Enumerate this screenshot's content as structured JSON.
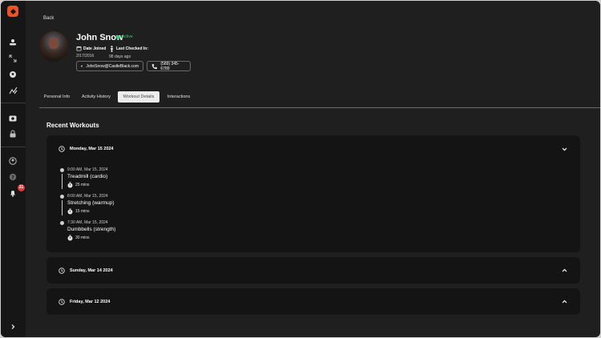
{
  "app": {
    "accent": "#e8542a",
    "notification_count": "21"
  },
  "sidebar": {
    "icons": [
      "logo-icon",
      "dashboard-icon",
      "expand-icon",
      "location-icon",
      "analytics-icon",
      "camera-icon",
      "lock-icon",
      "user-icon",
      "help-icon",
      "bell-icon",
      "chevron-right-icon"
    ]
  },
  "header": {
    "back_label": "Back"
  },
  "profile": {
    "name": "John Snow",
    "status": "Active",
    "status_color": "#2ecc71",
    "date_joined_label": "Date Joined",
    "date_joined_value": "2/17/2016",
    "last_checked_label": "Last Checked In:",
    "last_checked_value": "98 days ago",
    "email": "JohnSnow@CastleBlack.com",
    "phone": "(589) 345-6789"
  },
  "tabs": [
    {
      "label": "Personal Info",
      "active": false
    },
    {
      "label": "Activity History",
      "active": false
    },
    {
      "label": "Workout Details",
      "active": true
    },
    {
      "label": "Interactions",
      "active": false
    }
  ],
  "workouts": {
    "title": "Recent Workouts",
    "days": [
      {
        "date": "Monday, Mar 15 2024",
        "expanded": true,
        "items": [
          {
            "time": "9:00 AM, Mar 15, 2024",
            "name": "Treadmill (cardio)",
            "duration": "25 mins"
          },
          {
            "time": "8:00 AM, Mar 15, 2024",
            "name": "Stretching (warmup)",
            "duration": "15 mins"
          },
          {
            "time": "7:30 AM, Mar 15, 2024",
            "name": "Dumbbells (strength)",
            "duration": "30 mins"
          }
        ]
      },
      {
        "date": "Sunday, Mar 14 2024",
        "expanded": false,
        "items": []
      },
      {
        "date": "Friday, Mar 12 2024",
        "expanded": false,
        "items": []
      }
    ]
  }
}
